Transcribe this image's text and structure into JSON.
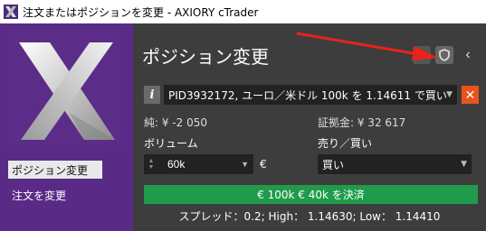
{
  "window": {
    "title": "注文またはポジションを変更 - AXIORY cTrader"
  },
  "sidebar": {
    "items": [
      {
        "label": "ポジション変更",
        "active": true
      },
      {
        "label": "注文を変更",
        "active": false
      }
    ]
  },
  "panel": {
    "title": "ポジション変更",
    "position_select": "PID3932172, ユーロ／米ドル 100k を 1.14611 で買い",
    "pl": "純: ¥ -2 050",
    "margin": "証拠金: ¥ 32 617",
    "volume_label": "ボリューム",
    "volume_value": "60k",
    "volume_currency": "€",
    "side_label": "売り／買い",
    "side_value": "買い",
    "close_button": "€ 100k € 40k を決済",
    "quote": "スプレッド：0.2; High： 1.14630; Low： 1.14410"
  },
  "colors": {
    "sidebar": "#5a2b86",
    "panel": "#3d3d3d",
    "close_button": "#1f9b4b",
    "close_x": "#e8541c",
    "arrow": "#e8231c"
  },
  "icons": {
    "info": "info-icon",
    "close": "close-icon",
    "shield": "shield-icon",
    "back": "chevron-left-icon"
  }
}
